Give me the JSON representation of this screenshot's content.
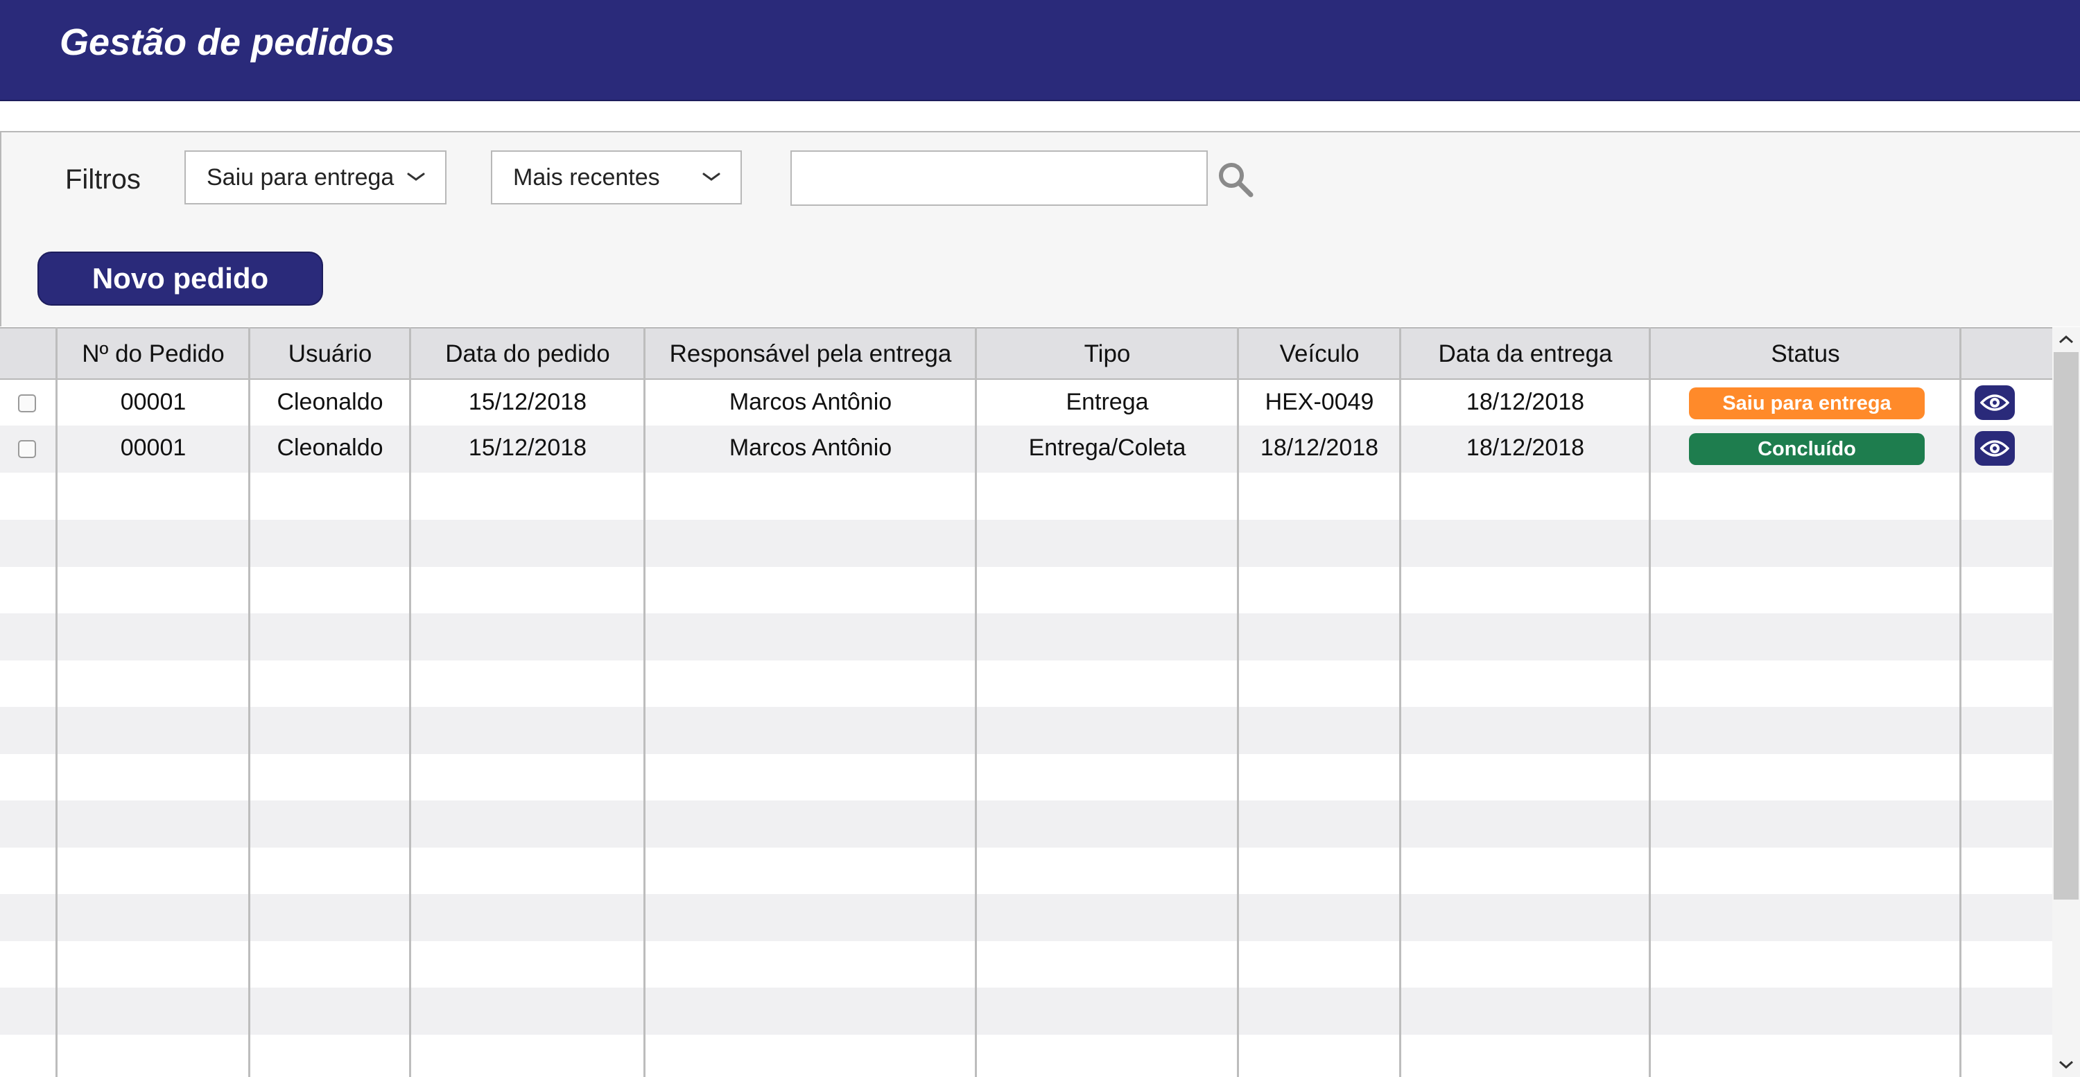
{
  "app": {
    "title": "Gestão de pedidos"
  },
  "filters": {
    "label": "Filtros",
    "status_select": {
      "value": "Saiu para entrega"
    },
    "order_select": {
      "value": "Mais recentes"
    },
    "search": {
      "value": "",
      "placeholder": ""
    }
  },
  "actions": {
    "new_order_label": "Novo pedido"
  },
  "table": {
    "columns": [
      "Nº do Pedido",
      "Usuário",
      "Data do pedido",
      "Responsável pela entrega",
      "Tipo",
      "Veículo",
      "Data da entrega",
      "Status"
    ],
    "rows": [
      {
        "order_no": "00001",
        "user": "Cleonaldo",
        "order_date": "15/12/2018",
        "responsible": "Marcos Antônio",
        "type": "Entrega",
        "vehicle": "HEX-0049",
        "delivery_date": "18/12/2018",
        "status": "Saiu para entrega",
        "status_color": "#ff8a2a"
      },
      {
        "order_no": "00001",
        "user": "Cleonaldo",
        "order_date": "15/12/2018",
        "responsible": "Marcos Antônio",
        "type": "Entrega/Coleta",
        "vehicle": "18/12/2018",
        "delivery_date": "18/12/2018",
        "status": "Concluído",
        "status_color": "#1e7d4e"
      }
    ]
  },
  "colors": {
    "brand": "#2a2a7a",
    "status_out_for_delivery": "#ff8a2a",
    "status_done": "#1e7d4e"
  },
  "icons": {
    "dropdown": "chevron-down-icon",
    "search": "search-icon",
    "view": "eye-icon",
    "scroll_up": "chevron-up-icon",
    "scroll_down": "chevron-down-icon"
  }
}
